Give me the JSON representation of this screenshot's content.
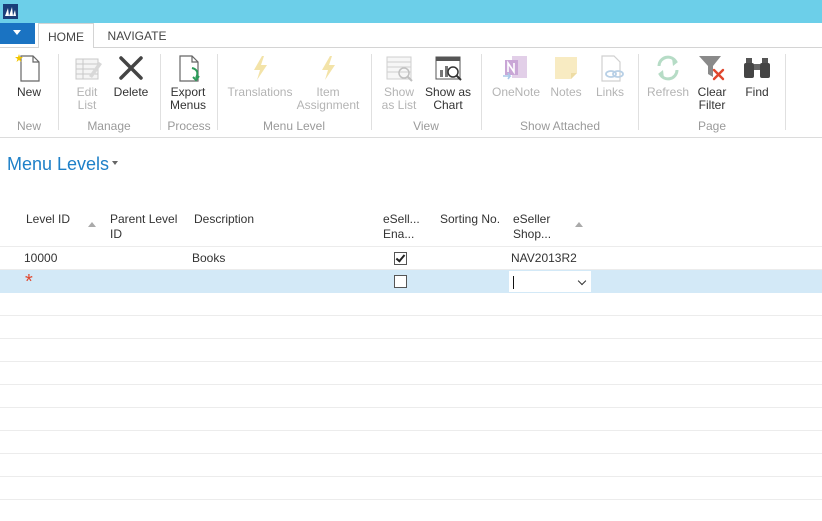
{
  "tabs": {
    "home": "HOME",
    "navigate": "NAVIGATE"
  },
  "ribbon": {
    "new": {
      "line1": "New",
      "icon": "new-document-icon"
    },
    "edit_list": {
      "line1": "Edit",
      "line2": "List",
      "icon": "edit-list-icon"
    },
    "delete": {
      "line1": "Delete",
      "icon": "delete-x-icon"
    },
    "export_menus": {
      "line1": "Export",
      "line2": "Menus",
      "icon": "export-document-icon"
    },
    "translations": {
      "line1": "Translations",
      "icon": "lightning-icon"
    },
    "item_assignment": {
      "line1": "Item",
      "line2": "Assignment",
      "icon": "lightning-icon"
    },
    "show_as_list": {
      "line1": "Show",
      "line2": "as List",
      "icon": "list-view-icon"
    },
    "show_as_chart": {
      "line1": "Show as",
      "line2": "Chart",
      "icon": "chart-view-icon"
    },
    "onenote": {
      "line1": "OneNote",
      "icon": "onenote-icon"
    },
    "notes": {
      "line1": "Notes",
      "icon": "notes-icon"
    },
    "links": {
      "line1": "Links",
      "icon": "links-icon"
    },
    "refresh": {
      "line1": "Refresh",
      "icon": "refresh-icon"
    },
    "clear_filter": {
      "line1": "Clear",
      "line2": "Filter",
      "icon": "clear-filter-icon"
    },
    "find": {
      "line1": "Find",
      "icon": "binoculars-icon"
    },
    "groups": {
      "new": "New",
      "manage": "Manage",
      "process": "Process",
      "menu_level": "Menu Level",
      "view": "View",
      "show_attached": "Show Attached",
      "page": "Page"
    }
  },
  "page": {
    "title": "Menu Levels"
  },
  "columns": {
    "level_id": "Level ID",
    "parent_level_id_1": "Parent Level",
    "parent_level_id_2": "ID",
    "description": "Description",
    "eseller_enabled_1": "eSell...",
    "eseller_enabled_2": "Ena...",
    "sorting_no": "Sorting No.",
    "eseller_shop_1": "eSeller",
    "eseller_shop_2": "Shop..."
  },
  "rows": [
    {
      "level_id": "10000",
      "parent_level_id": "",
      "description": "Books",
      "eseller_enabled": true,
      "sorting_no": "",
      "eseller_shop": "NAV2013R2"
    }
  ],
  "new_row": {
    "marker": "*",
    "eseller_enabled": false,
    "eseller_shop": ""
  },
  "colors": {
    "titlebar": "#6ccfe9",
    "accent": "#1a73c2",
    "title_text": "#1e80c8",
    "selected_row": "#d3e9f7",
    "new_marker": "#e0472e"
  }
}
